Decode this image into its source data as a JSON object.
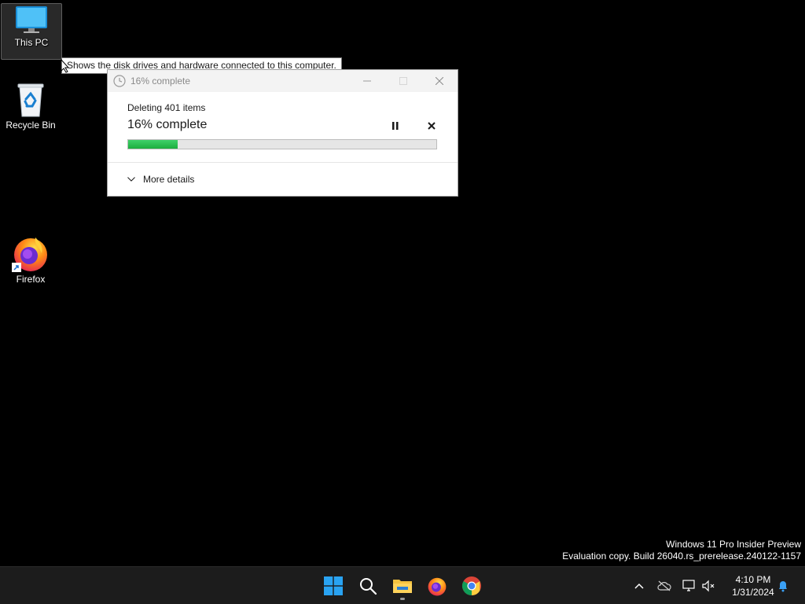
{
  "desktop": {
    "icons": [
      {
        "id": "this-pc",
        "label": "This PC"
      },
      {
        "id": "recycle-bin",
        "label": "Recycle Bin"
      },
      {
        "id": "firefox",
        "label": "Firefox"
      }
    ],
    "tooltip": "Shows the disk drives and hardware connected to this computer."
  },
  "dialog": {
    "title": "16% complete",
    "operation": "Deleting 401 items",
    "percent_label": "16% complete",
    "progress": 0.16,
    "more_details": "More details",
    "accent": "#1cae3e"
  },
  "watermark": {
    "line1": "Windows 11 Pro Insider Preview",
    "line2": "Evaluation copy. Build 26040.rs_prerelease.240122-1157"
  },
  "taskbar": {
    "apps": [
      "start-icon",
      "search-icon",
      "file-explorer-icon",
      "firefox-icon",
      "chrome-icon"
    ],
    "time": "4:10 PM",
    "date": "1/31/2024",
    "tray": [
      "chevron-up-icon",
      "onedrive-offline-icon",
      "network-icon",
      "volume-muted-icon",
      "notification-bell-icon"
    ]
  },
  "colors": {
    "desktop_bg": "#000000",
    "taskbar_bg": "#1c1c1c",
    "windows_blue": "#0a8fe8"
  }
}
